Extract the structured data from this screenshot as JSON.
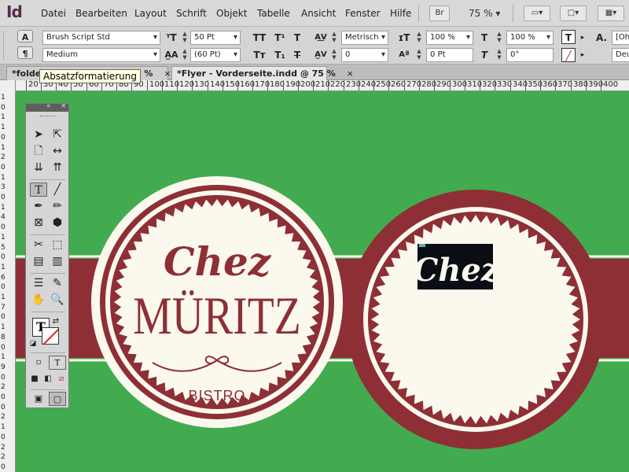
{
  "app": {
    "logo": "Id"
  },
  "menu": [
    "Datei",
    "Bearbeiten",
    "Layout",
    "Schrift",
    "Objekt",
    "Tabelle",
    "Ansicht",
    "Fenster",
    "Hilfe"
  ],
  "menubar_right": {
    "bridge": "Br",
    "zoom": "75 %"
  },
  "control": {
    "font_family": "Brush Script Std",
    "font_style": "Medium",
    "font_size": "50 Pt",
    "leading": "(60 Pt)",
    "kerning": "Metrisch",
    "tracking": "0",
    "vscale": "100 %",
    "hscale": "100 %",
    "baseline": "0 Pt",
    "skew": "0°",
    "char_style": "[Oh",
    "lang": "Deu"
  },
  "tabs": [
    {
      "label": "*folder",
      "suffix": "@ 75 %"
    },
    {
      "label": "*Flyer - Vorderseite.indd @ 75 %"
    }
  ],
  "tooltip": "Absatzformatierung",
  "ruler_labels": [
    "20",
    "30",
    "40",
    "50",
    "60",
    "70",
    "80",
    "90",
    "100",
    "110",
    "120",
    "130",
    "140",
    "150",
    "160",
    "170",
    "180",
    "190",
    "200",
    "210",
    "220",
    "230",
    "240",
    "250",
    "260",
    "270",
    "280",
    "290"
  ],
  "left_ruler_labels": [
    "1",
    "0",
    "1",
    "1",
    "0",
    "1",
    "2",
    "0",
    "1",
    "3",
    "0",
    "1",
    "4",
    "0",
    "1",
    "5",
    "0",
    "1",
    "6",
    "0",
    "1",
    "7",
    "0",
    "1",
    "8",
    "0",
    "1",
    "9",
    "0",
    "2",
    "0",
    "0",
    "2",
    "1",
    "0",
    "2",
    "2",
    "0"
  ],
  "logo": {
    "chez": "Chez",
    "name": "MÜRITZ",
    "bistro": "BISTRO",
    "selected_text": "Chez"
  },
  "colors": {
    "green": "#43ab4f",
    "maroon": "#8e2f36",
    "cream": "#fbf9ee",
    "selection": "#0a0d14"
  },
  "tools": [
    "selection-icon",
    "direct-selection-icon",
    "page-icon",
    "gap-icon",
    "content-collector-icon",
    "content-placer-icon",
    "type-icon",
    "line-icon",
    "pen-icon",
    "pencil-icon",
    "rectangle-frame-icon",
    "polygon-icon",
    "scissors-icon",
    "free-transform-icon",
    "gradient-swatch-icon",
    "gradient-feather-icon",
    "note-icon",
    "eyedropper-icon",
    "hand-icon",
    "zoom-icon"
  ]
}
